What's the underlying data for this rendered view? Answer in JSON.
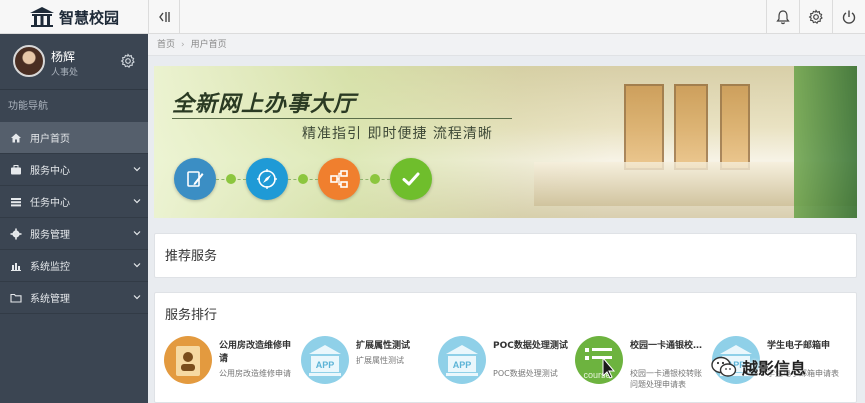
{
  "app": {
    "name": "智慧校园"
  },
  "user": {
    "name": "杨辉",
    "dept": "人事处"
  },
  "sidebar": {
    "title": "功能导航",
    "items": [
      {
        "label": "用户首页",
        "icon": "home-icon",
        "active": true
      },
      {
        "label": "服务中心",
        "icon": "briefcase-icon"
      },
      {
        "label": "任务中心",
        "icon": "list-icon"
      },
      {
        "label": "服务管理",
        "icon": "gear-icon"
      },
      {
        "label": "系统监控",
        "icon": "bar-chart-icon"
      },
      {
        "label": "系统管理",
        "icon": "folder-icon"
      }
    ]
  },
  "breadcrumb": {
    "home": "首页",
    "current": "用户首页"
  },
  "banner": {
    "title": "全新网上办事大厅",
    "subtitle": "精准指引  即时便捷  流程清晰",
    "steps": [
      {
        "icon": "pen-icon",
        "color": "#3b8ec4"
      },
      {
        "icon": "compass-icon",
        "color": "#1f9ad6"
      },
      {
        "icon": "flow-icon",
        "color": "#f07f2e"
      },
      {
        "icon": "check-icon",
        "color": "#6fbe2c"
      }
    ]
  },
  "recommended": {
    "title": "推荐服务"
  },
  "ranking": {
    "title": "服务排行",
    "items": [
      {
        "title": "公用房改造维修申请",
        "sub": "公用房改造维修申请"
      },
      {
        "title": "扩展属性测试",
        "sub": "扩展属性测试"
      },
      {
        "title": "POC数据处理测试",
        "sub": "POC数据处理测试"
      },
      {
        "title": "校园一卡通银校…",
        "sub": "校园一卡通银校转账问题处理申请表",
        "icon_text": "course"
      },
      {
        "title": "学生电子邮箱申",
        "sub": "学生电子邮箱申请表"
      }
    ]
  },
  "icons": {
    "app_icon_text": "APP"
  },
  "watermark": {
    "text": "越影信息"
  }
}
